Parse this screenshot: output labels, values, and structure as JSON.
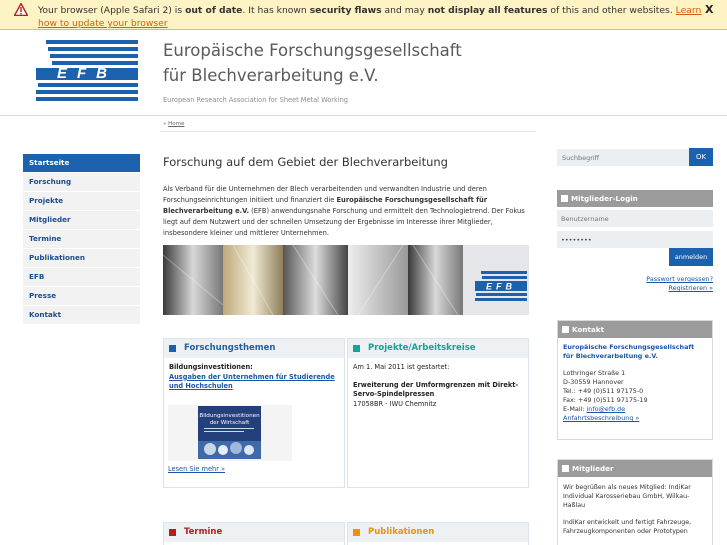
{
  "warning": {
    "prefix": "Your browser (Apple Safari 2) is ",
    "bold1": "out of date",
    "mid1": ". It has known ",
    "bold2": "security flaws",
    "mid2": " and may ",
    "bold3": "not display all features",
    "mid3": " of this and other websites. ",
    "link": "Learn how to update your browser",
    "close": "X"
  },
  "header": {
    "title_line1": "Europäische Forschungsgesellschaft",
    "title_line2": "für Blechverarbeitung e.V.",
    "subtitle": "European Research Association for Sheet Metal Working",
    "logo_text": "EFB"
  },
  "breadcrumb": {
    "prefix": "» ",
    "home": "Home"
  },
  "nav": {
    "items": [
      {
        "label": "Startseite",
        "active": true
      },
      {
        "label": "Forschung"
      },
      {
        "label": "Projekte"
      },
      {
        "label": "Mitglieder"
      },
      {
        "label": "Termine"
      },
      {
        "label": "Publikationen"
      },
      {
        "label": "EFB"
      },
      {
        "label": "Presse"
      },
      {
        "label": "Kontakt"
      }
    ]
  },
  "main": {
    "heading": "Forschung auf dem Gebiet der Blechverarbeitung",
    "intro_part1": "Als Verband für die Unternehmen der Blech verarbeitenden und verwandten Industrie und deren Forschungseinrichtungen initiiert und finanziert die ",
    "intro_bold": "Europäische Forschungsgesellschaft für Blechverarbeitung e.V.",
    "intro_part2": " (EFB) anwendungsnahe Forschung und ermittelt den Technologietrend. Der Fokus liegt auf dem Nutzwert und der schnellen Umsetzung der Ergebnisse im Interesse ihrer Mitglieder, insbesondere kleiner und mittlerer Unternehmen."
  },
  "boxes": {
    "forschung": {
      "title": "Forschungsthemen",
      "color": "#1c61ae",
      "label": "Bildungsinvestitionen:",
      "link": "Ausgaben der Unternehmen für Studierende und Hochschulen",
      "book_title_line1": "Bildungsinvestitionen",
      "book_title_line2": "der Wirtschaft",
      "more": "Lesen Sie mehr »"
    },
    "projekte": {
      "title": "Projekte/Arbeitskreise",
      "color": "#14a398",
      "date_text": "Am 1. Mai 2011 ist gestartet:",
      "project_title": "Erweiterung der Umformgrenzen mit Direkt-Servo-Spindelpressen",
      "project_id": "17058BR - IWU Chemnitz"
    },
    "termine": {
      "title": "Termine",
      "color": "#b01e1e"
    },
    "publikationen": {
      "title": "Publikationen",
      "color": "#e8920e"
    }
  },
  "search": {
    "placeholder": "Suchbegriff",
    "button": "OK"
  },
  "login": {
    "title": "Mitglieder-Login",
    "username": "Benutzername",
    "password": "••••••••",
    "button": "anmelden",
    "forgot": "Passwort vergessen?",
    "register": "Registrieren »"
  },
  "contact": {
    "title": "Kontakt",
    "org_line1": "Europäische Forschungsgesellschaft",
    "org_line2": "für Blechverarbeitung e.V.",
    "street": "Lothringer Straße 1",
    "city": "D-30559 Hannover",
    "tel": "Tel.: +49 (0)511 97175-0",
    "fax": "Fax: +49 (0)511 97175-19",
    "email_label": "E-Mail: ",
    "email": "info@efb.de",
    "directions": "Anfahrtsbeschreibung »"
  },
  "members": {
    "title": "Mitglieder",
    "text1": "Wir begrüßen als neues Mitglied: IndiKar Individual Karosseriebau GmbH, Wilkau-Haßlau",
    "text2": "IndiKar entwickelt und fertigt Fahrzeuge, Fahrzeugkomponenten oder Prototypen"
  }
}
